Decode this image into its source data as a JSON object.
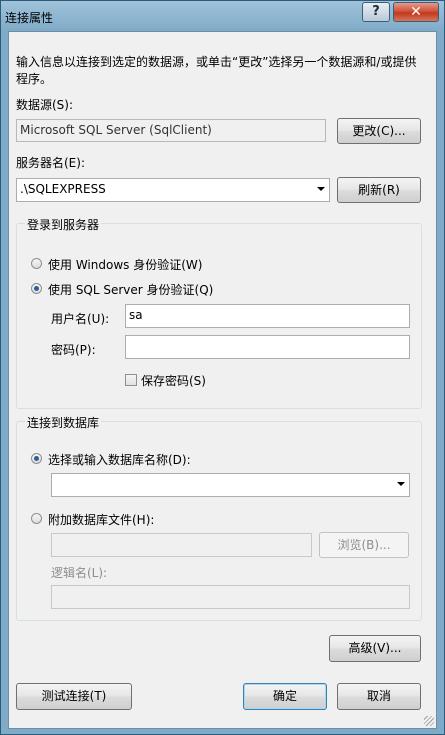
{
  "window": {
    "title": "连接属性",
    "help_label": "?",
    "close_label": "✕"
  },
  "description": "输入信息以连接到选定的数据源，或单击“更改”选择另一个数据源和/或提供程序。",
  "datasource": {
    "label": "数据源(S):",
    "value": "Microsoft SQL Server (SqlClient)",
    "change_button": "更改(C)..."
  },
  "server": {
    "label": "服务器名(E):",
    "value": ".\\SQLEXPRESS",
    "refresh_button": "刷新(R)"
  },
  "login_group": {
    "title": "登录到服务器",
    "windows_auth": "使用 Windows 身份验证(W)",
    "sql_auth": "使用 SQL Server 身份验证(Q)",
    "selected": "sql_auth",
    "username_label": "用户名(U):",
    "username_value": "sa",
    "password_label": "密码(P):",
    "password_value": "",
    "save_password": "保存密码(S)",
    "save_password_checked": false
  },
  "db_group": {
    "title": "连接到数据库",
    "select_db": "选择或输入数据库名称(D):",
    "select_db_value": "",
    "attach_file": "附加数据库文件(H):",
    "attach_file_value": "",
    "browse_button": "浏览(B)...",
    "logical_name_label": "逻辑名(L):",
    "logical_name_value": "",
    "selected": "select_db"
  },
  "buttons": {
    "advanced": "高级(V)...",
    "test": "测试连接(T)",
    "ok": "确定",
    "cancel": "取消"
  }
}
